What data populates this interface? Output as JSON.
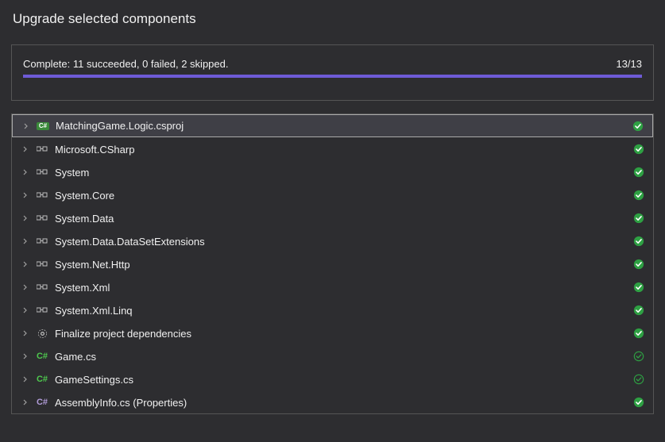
{
  "title": "Upgrade selected components",
  "progress": {
    "status_text": "Complete: 11 succeeded, 0 failed, 2 skipped.",
    "count": "13/13",
    "fill_percent": 100
  },
  "items": [
    {
      "label": "MatchingGame.Logic.csproj",
      "icon": "csproj",
      "selected": true,
      "status": "success"
    },
    {
      "label": "Microsoft.CSharp",
      "icon": "reference",
      "selected": false,
      "status": "success"
    },
    {
      "label": "System",
      "icon": "reference",
      "selected": false,
      "status": "success"
    },
    {
      "label": "System.Core",
      "icon": "reference",
      "selected": false,
      "status": "success"
    },
    {
      "label": "System.Data",
      "icon": "reference",
      "selected": false,
      "status": "success"
    },
    {
      "label": "System.Data.DataSetExtensions",
      "icon": "reference",
      "selected": false,
      "status": "success"
    },
    {
      "label": "System.Net.Http",
      "icon": "reference",
      "selected": false,
      "status": "success"
    },
    {
      "label": "System.Xml",
      "icon": "reference",
      "selected": false,
      "status": "success"
    },
    {
      "label": "System.Xml.Linq",
      "icon": "reference",
      "selected": false,
      "status": "success"
    },
    {
      "label": "Finalize project dependencies",
      "icon": "gear",
      "selected": false,
      "status": "success"
    },
    {
      "label": "Game.cs",
      "icon": "cs-green",
      "selected": false,
      "status": "success-outline"
    },
    {
      "label": "GameSettings.cs",
      "icon": "cs-green",
      "selected": false,
      "status": "success-outline"
    },
    {
      "label": "AssemblyInfo.cs (Properties)",
      "icon": "cs-purple",
      "selected": false,
      "status": "success"
    }
  ]
}
